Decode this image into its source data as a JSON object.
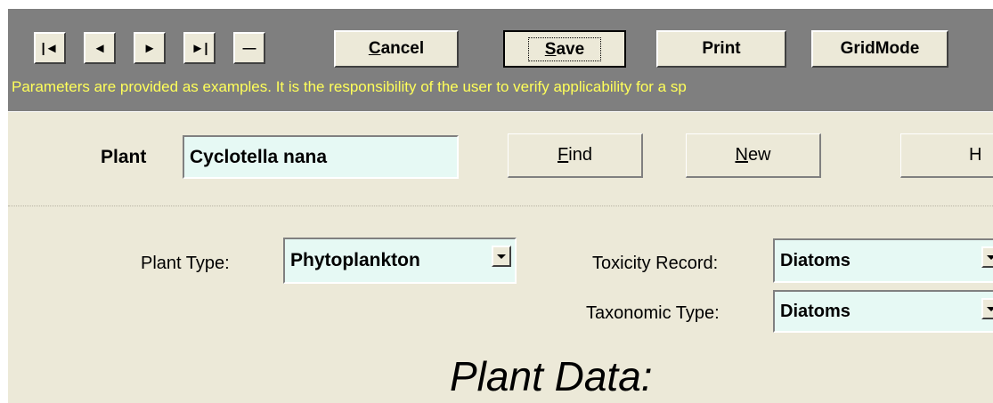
{
  "nav": {
    "first": "|◄",
    "prev": "◄",
    "next": "►",
    "last": "►|",
    "delete": "—"
  },
  "toolbar": {
    "cancel_first": "C",
    "cancel_rest": "ancel",
    "save_first": "S",
    "save_rest": "ave",
    "print_label": "Print",
    "gridmode_label": "GridMode",
    "disclaimer": "Parameters are provided as examples.  It is the responsibility of the user to verify applicability for a sp"
  },
  "header": {
    "plant_label": "Plant",
    "plant_value": "Cyclotella nana",
    "find_first": "F",
    "find_rest": "ind",
    "new_first": "N",
    "new_rest": "ew",
    "cut_button_label": "H"
  },
  "form": {
    "plant_type_label": "Plant Type:",
    "plant_type_value": "Phytoplankton",
    "toxicity_label": "Toxicity Record:",
    "toxicity_value": "Diatoms",
    "taxonomic_label": "Taxonomic Type:",
    "taxonomic_value": "Diatoms",
    "section_title": "Plant Data:"
  },
  "colors": {
    "toolbar_bg": "#7f7f7f",
    "form_bg": "#ece9d8",
    "field_bg": "#e6f9f4",
    "disclaimer_text": "#ffff5a"
  }
}
